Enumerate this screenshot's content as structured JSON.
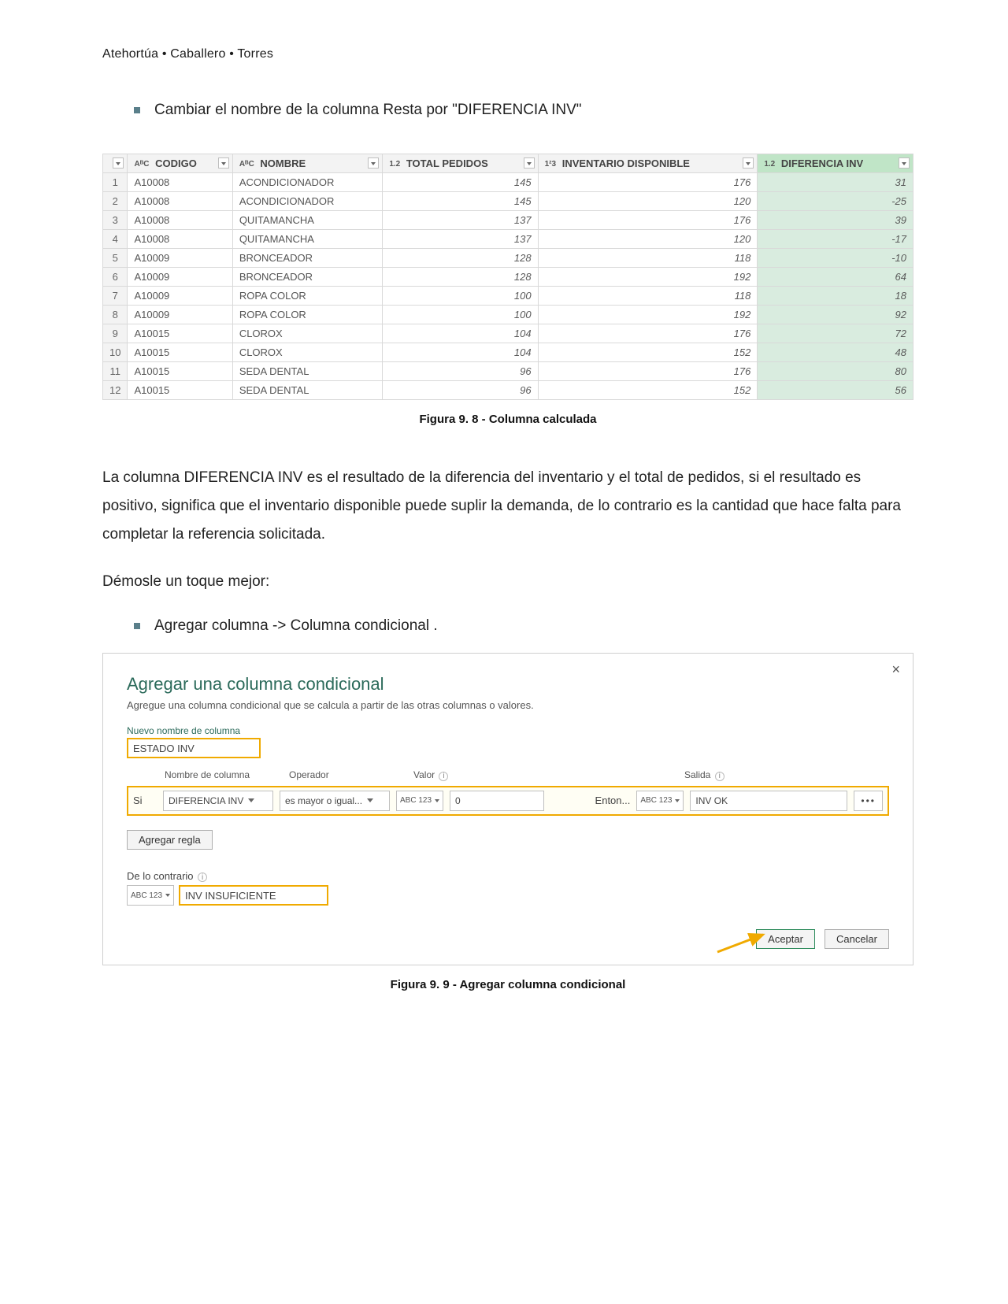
{
  "running_head": "Atehortúa • Caballero • Torres",
  "bullets": {
    "rename": "Cambiar el nombre de la columna Resta por \"DIFERENCIA INV\"",
    "add_conditional": "Agregar columna -> Columna condicional ."
  },
  "table": {
    "type_abc": "AᴮC",
    "type_12": "1.2",
    "type_123": "1²3",
    "headers": {
      "codigo": "CODIGO",
      "nombre": "NOMBRE",
      "total_pedidos": "TOTAL PEDIDOS",
      "inventario": "INVENTARIO DISPONIBLE",
      "diferencia": "DIFERENCIA INV"
    },
    "rows": [
      {
        "n": "1",
        "codigo": "A10008",
        "nombre": "ACONDICIONADOR",
        "total": "145",
        "inv": "176",
        "dif": "31"
      },
      {
        "n": "2",
        "codigo": "A10008",
        "nombre": "ACONDICIONADOR",
        "total": "145",
        "inv": "120",
        "dif": "-25"
      },
      {
        "n": "3",
        "codigo": "A10008",
        "nombre": "QUITAMANCHA",
        "total": "137",
        "inv": "176",
        "dif": "39"
      },
      {
        "n": "4",
        "codigo": "A10008",
        "nombre": "QUITAMANCHA",
        "total": "137",
        "inv": "120",
        "dif": "-17"
      },
      {
        "n": "5",
        "codigo": "A10009",
        "nombre": "BRONCEADOR",
        "total": "128",
        "inv": "118",
        "dif": "-10"
      },
      {
        "n": "6",
        "codigo": "A10009",
        "nombre": "BRONCEADOR",
        "total": "128",
        "inv": "192",
        "dif": "64"
      },
      {
        "n": "7",
        "codigo": "A10009",
        "nombre": "ROPA COLOR",
        "total": "100",
        "inv": "118",
        "dif": "18"
      },
      {
        "n": "8",
        "codigo": "A10009",
        "nombre": "ROPA COLOR",
        "total": "100",
        "inv": "192",
        "dif": "92"
      },
      {
        "n": "9",
        "codigo": "A10015",
        "nombre": "CLOROX",
        "total": "104",
        "inv": "176",
        "dif": "72"
      },
      {
        "n": "10",
        "codigo": "A10015",
        "nombre": "CLOROX",
        "total": "104",
        "inv": "152",
        "dif": "48"
      },
      {
        "n": "11",
        "codigo": "A10015",
        "nombre": "SEDA DENTAL",
        "total": "96",
        "inv": "176",
        "dif": "80"
      },
      {
        "n": "12",
        "codigo": "A10015",
        "nombre": "SEDA DENTAL",
        "total": "96",
        "inv": "152",
        "dif": "56"
      }
    ]
  },
  "captions": {
    "fig8": "Figura 9. 8 - Columna calculada",
    "fig9": "Figura 9. 9 - Agregar columna condicional"
  },
  "paragraphs": {
    "p1": "La columna DIFERENCIA INV es el resultado de la diferencia del inventario y el total de pedidos, si el resultado es positivo, significa que el inventario disponible puede suplir la demanda, de lo contrario es la cantidad que hace falta para completar la referencia solicitada.",
    "p2": "Démosle un toque mejor:"
  },
  "dialog": {
    "title": "Agregar una columna condicional",
    "subtitle": "Agregue una columna condicional que se calcula a partir de las otras columnas o valores.",
    "new_col_label": "Nuevo nombre de columna",
    "new_col_value": "ESTADO INV",
    "labels": {
      "col": "Nombre de columna",
      "op": "Operador",
      "val": "Valor",
      "out": "Salida"
    },
    "if": "Si",
    "then": "Enton...",
    "rule": {
      "column": "DIFERENCIA INV",
      "operator": "es mayor o igual...",
      "value": "0",
      "output": "INV OK",
      "type_badge": "ABC 123"
    },
    "add_rule": "Agregar regla",
    "else_label": "De lo contrario",
    "else_value": "INV INSUFICIENTE",
    "ellipsis": "•••",
    "buttons": {
      "ok": "Aceptar",
      "cancel": "Cancelar"
    },
    "info": "i"
  }
}
